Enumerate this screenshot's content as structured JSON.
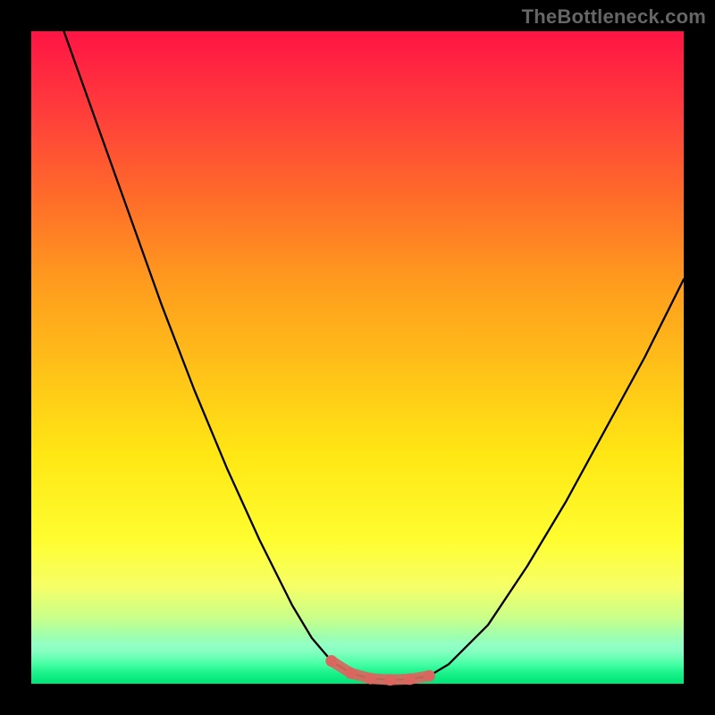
{
  "watermark": "TheBottleneck.com",
  "chart_data": {
    "type": "line",
    "title": "",
    "xlabel": "",
    "ylabel": "",
    "xlim": [
      0,
      100
    ],
    "ylim": [
      0,
      100
    ],
    "grid": false,
    "background_gradient": [
      "#ff1444",
      "#ffe714",
      "#00e87a"
    ],
    "series": [
      {
        "name": "curve",
        "color": "#000000",
        "x": [
          5,
          10,
          15,
          20,
          25,
          30,
          35,
          40,
          43,
          46,
          49,
          52,
          55,
          58,
          61,
          64,
          70,
          76,
          82,
          88,
          94,
          100
        ],
        "y": [
          100,
          86,
          72,
          58,
          45,
          33,
          22,
          12,
          7,
          3.5,
          1.6,
          0.8,
          0.6,
          0.7,
          1.2,
          3.0,
          9,
          18,
          28,
          39,
          50,
          62
        ]
      },
      {
        "name": "threshold-band",
        "color": "#d9675f",
        "x": [
          46,
          49,
          52,
          55,
          58,
          61
        ],
        "y": [
          3.5,
          1.6,
          0.8,
          0.6,
          0.7,
          1.2
        ]
      }
    ],
    "annotations": []
  }
}
